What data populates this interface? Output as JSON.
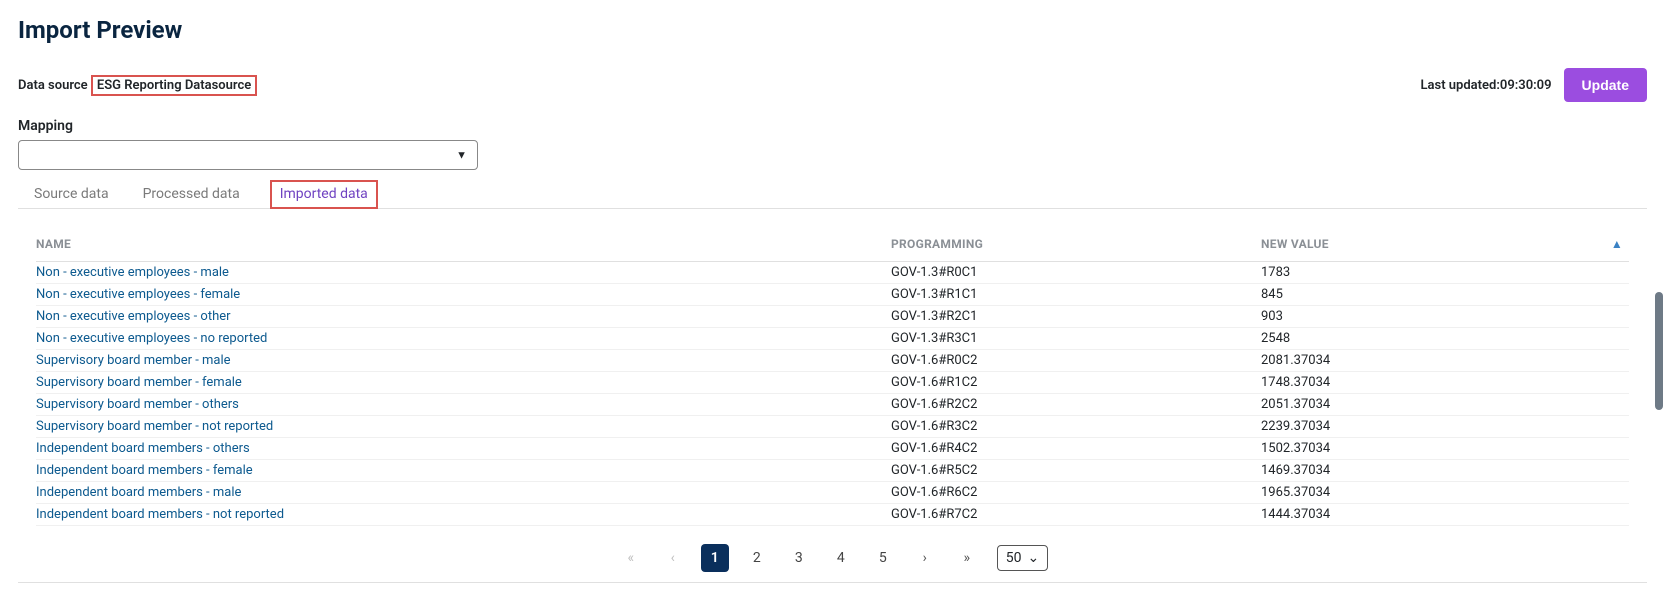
{
  "page": {
    "title": "Import Preview"
  },
  "header": {
    "datasource_label": "Data source",
    "datasource_name": "ESG Reporting Datasource",
    "last_updated_label": "Last updated:",
    "last_updated_value": "09:30:09",
    "update_label": "Update"
  },
  "mapping": {
    "label": "Mapping",
    "selected": ""
  },
  "tabs": [
    {
      "label": "Source data",
      "active": false
    },
    {
      "label": "Processed data",
      "active": false
    },
    {
      "label": "Imported data",
      "active": true
    }
  ],
  "table": {
    "columns": {
      "name": "NAME",
      "programming": "PROGRAMMING",
      "new_value": "NEW VALUE"
    },
    "rows": [
      {
        "name": "Non - executive employees - male",
        "programming": "GOV-1.3#R0C1",
        "new_value": "1783"
      },
      {
        "name": "Non - executive employees - female",
        "programming": "GOV-1.3#R1C1",
        "new_value": "845"
      },
      {
        "name": "Non - executive employees - other",
        "programming": "GOV-1.3#R2C1",
        "new_value": "903"
      },
      {
        "name": "Non - executive employees - no reported",
        "programming": "GOV-1.3#R3C1",
        "new_value": "2548"
      },
      {
        "name": "Supervisory board member - male",
        "programming": "GOV-1.6#R0C2",
        "new_value": "2081.37034"
      },
      {
        "name": "Supervisory board member - female",
        "programming": "GOV-1.6#R1C2",
        "new_value": "1748.37034"
      },
      {
        "name": "Supervisory board member - others",
        "programming": "GOV-1.6#R2C2",
        "new_value": "2051.37034"
      },
      {
        "name": "Supervisory board member - not reported",
        "programming": "GOV-1.6#R3C2",
        "new_value": "2239.37034"
      },
      {
        "name": "Independent board members - others",
        "programming": "GOV-1.6#R4C2",
        "new_value": "1502.37034"
      },
      {
        "name": "Independent board members - female",
        "programming": "GOV-1.6#R5C2",
        "new_value": "1469.37034"
      },
      {
        "name": "Independent board members - male",
        "programming": "GOV-1.6#R6C2",
        "new_value": "1965.37034"
      },
      {
        "name": "Independent board members - not reported",
        "programming": "GOV-1.6#R7C2",
        "new_value": "1444.37034"
      }
    ]
  },
  "pagination": {
    "pages": [
      "1",
      "2",
      "3",
      "4",
      "5"
    ],
    "current": "1",
    "page_size": "50"
  }
}
